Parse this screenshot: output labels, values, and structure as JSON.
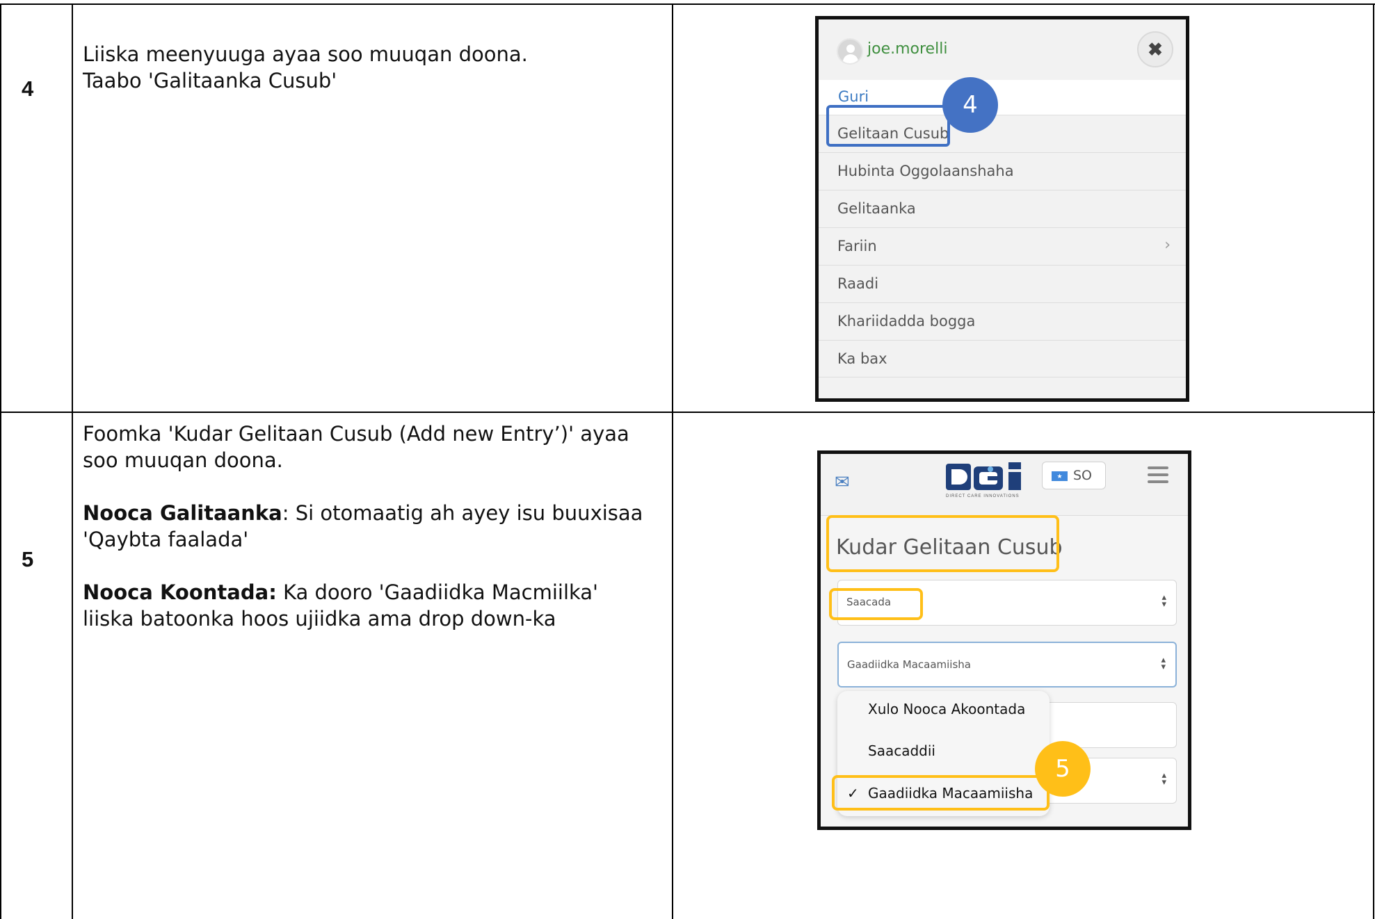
{
  "steps": [
    {
      "number": "4",
      "lines": [
        "Liiska meenyuuga ayaa soo muuqan doona.",
        "Taabo 'Galitaanka Cusub'"
      ]
    },
    {
      "number": "5",
      "intro": [
        "Foomka 'Kudar Gelitaan Cusub (Add new Entry’)' ayaa",
        "soo muuqan doona."
      ],
      "entry_type_label": "Nooca Galitaanka",
      "entry_type_text_1": ": Si otomaatig ah ayey isu buuxisaa",
      "entry_type_text_2": "'Qaybta faalada'",
      "account_type_label": "Nooca Koontada:",
      "account_type_text_1": " Ka dooro 'Gaadiidka Macmiilka'",
      "account_type_text_2": "liiska batoonka hoos ujiidka ama drop down-ka"
    }
  ],
  "menu_screen": {
    "username": "joe.morelli",
    "close_glyph": "✖",
    "items": [
      "Guri",
      "Gelitaan Cusub",
      "Hubinta Oggolaanshaha",
      "Gelitaanka",
      "Fariin",
      "Raadi",
      "Khariidadda bogga",
      "Ka bax"
    ],
    "fariin_chevron": "›",
    "badge": "4"
  },
  "form_screen": {
    "mail_glyph": "✉",
    "logo_tagline": "DIRECT CARE INNOVATIONS",
    "language": "SO",
    "title": "Kudar Gelitaan Cusub",
    "entry_type_value": "Saacada",
    "account_type_value": "Gaadiidka Macaamiisha",
    "dropdown_options": [
      "Xulo Nooca Akoontada",
      "Saacaddii",
      "Gaadiidka Macaamiisha"
    ],
    "check_glyph": "✓",
    "badge": "5"
  },
  "colors": {
    "highlight_blue": "#4472c4",
    "highlight_gold": "#ffbf18",
    "username_green": "#3f8f3f",
    "link_blue": "#3b7ac2"
  }
}
